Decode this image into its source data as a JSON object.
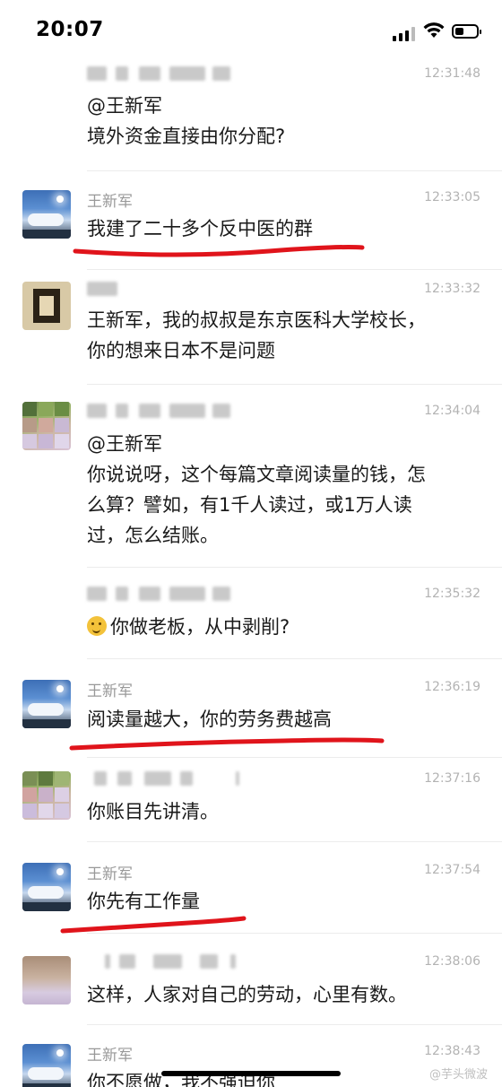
{
  "status_bar": {
    "time": "20:07",
    "battery_level": 0.3
  },
  "messages": [
    {
      "sender": "",
      "time": "12:31:48",
      "text": "@王新军\n境外资金直接由你分配?"
    },
    {
      "sender": "王新军",
      "time": "12:33:05",
      "text": "我建了二十多个反中医的群",
      "underlined": true
    },
    {
      "sender": "",
      "time": "12:33:32",
      "text": "王新军，我的叔叔是东京医科大学校长，\n你的想来日本不是问题"
    },
    {
      "sender": "",
      "time": "12:34:04",
      "text": "@王新军\n你说说呀，这个每篇文章阅读量的钱，怎\n么算？譬如，有1千人读过，或1万人读\n过，怎么结账。"
    },
    {
      "sender": "",
      "time": "12:35:32",
      "text": "你做老板，从中剥削?",
      "emoji": "thinking-face"
    },
    {
      "sender": "王新军",
      "time": "12:36:19",
      "text": "阅读量越大，你的劳务费越高",
      "underlined": true
    },
    {
      "sender": "",
      "time": "12:37:16",
      "text": "你账目先讲清。"
    },
    {
      "sender": "王新军",
      "time": "12:37:54",
      "text": "你先有工作量",
      "underlined": true
    },
    {
      "sender": "",
      "time": "12:38:06",
      "text": "这样，人家对自己的劳动，心里有数。"
    },
    {
      "sender": "王新军",
      "time": "12:38:43",
      "text": "你不愿做，我不强迫你"
    }
  ],
  "watermark": "@芋头微波",
  "colors": {
    "underline": "#e0141b",
    "timestamp": "#b3b3b3",
    "sender": "#999999"
  }
}
